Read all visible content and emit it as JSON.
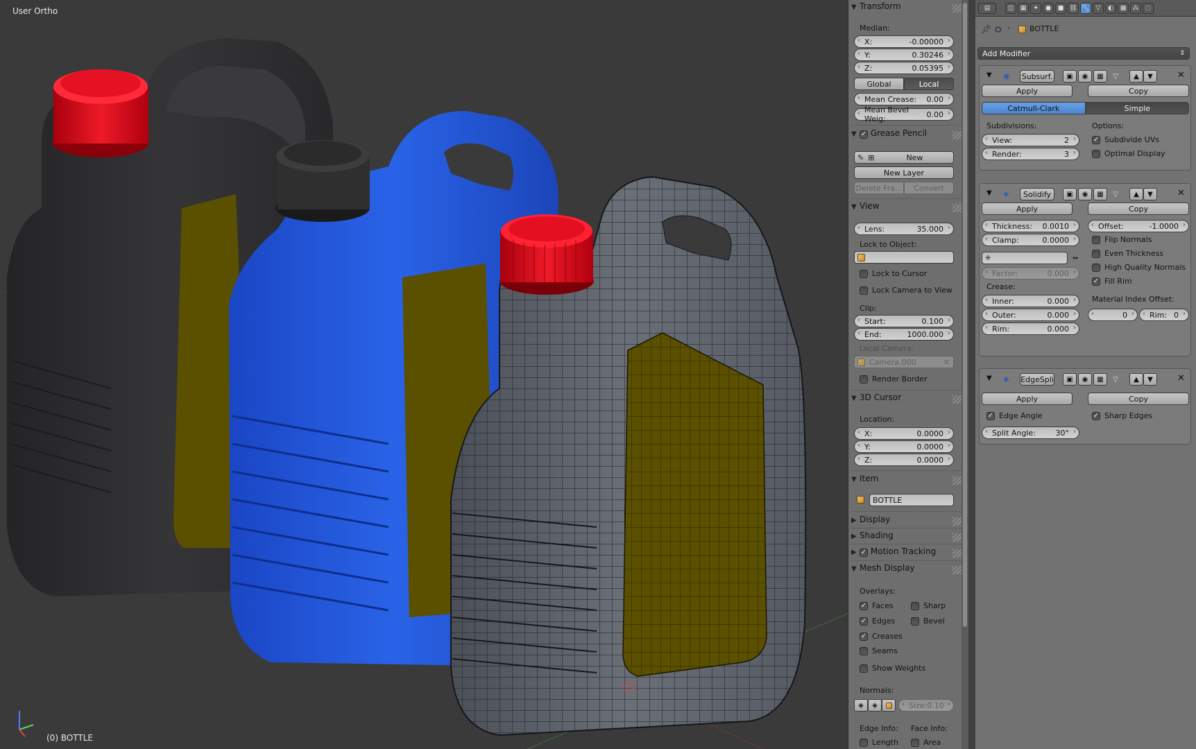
{
  "viewport": {
    "view_name": "User Ortho",
    "object_label": "(0) BOTTLE"
  },
  "npanel": {
    "transform": {
      "header": "Transform",
      "median_label": "Median:",
      "x": {
        "label": "X:",
        "value": "-0.00000"
      },
      "y": {
        "label": "Y:",
        "value": "0.30246"
      },
      "z": {
        "label": "Z:",
        "value": "0.05395"
      },
      "global_label": "Global",
      "local_label": "Local",
      "mean_crease": {
        "label": "Mean Crease:",
        "value": "0.00"
      },
      "mean_bevel": {
        "label": "Mean Bevel Weig:",
        "value": "0.00"
      }
    },
    "grease_pencil": {
      "header": "Grease Pencil",
      "new_label": "New",
      "new_layer_label": "New Layer",
      "delete_frame_label": "Delete Fra...",
      "convert_label": "Convert"
    },
    "view": {
      "header": "View",
      "lens": {
        "label": "Lens:",
        "value": "35.000"
      },
      "lock_to_object_label": "Lock to Object:",
      "lock_to_cursor_label": "Lock to Cursor",
      "lock_camera_label": "Lock Camera to View",
      "clip_label": "Clip:",
      "start": {
        "label": "Start:",
        "value": "0.100"
      },
      "end": {
        "label": "End:",
        "value": "1000.000"
      },
      "local_camera_label": "Local Camera:",
      "camera_value": "Camera.000",
      "render_border_label": "Render Border"
    },
    "cursor": {
      "header": "3D Cursor",
      "location_label": "Location:",
      "x": {
        "label": "X:",
        "value": "0.0000"
      },
      "y": {
        "label": "Y:",
        "value": "0.0000"
      },
      "z": {
        "label": "Z:",
        "value": "0.0000"
      }
    },
    "item": {
      "header": "Item",
      "name": "BOTTLE"
    },
    "display_header": "Display",
    "shading_header": "Shading",
    "motion_tracking_header": "Motion Tracking",
    "mesh_display": {
      "header": "Mesh Display",
      "overlays_label": "Overlays:",
      "faces_label": "Faces",
      "sharp_label": "Sharp",
      "edges_label": "Edges",
      "bevel_label": "Bevel",
      "creases_label": "Creases",
      "seams_label": "Seams",
      "show_weights_label": "Show Weights",
      "normals_label": "Normals:",
      "size": {
        "label": "Size:",
        "value": "0.10"
      },
      "edge_info_label": "Edge Info:",
      "face_info_label": "Face Info:",
      "length_label": "Length",
      "area_label": "Area"
    }
  },
  "properties": {
    "object_name": "BOTTLE",
    "add_modifier_label": "Add Modifier",
    "subsurf": {
      "name": "Subsurf.",
      "apply_label": "Apply",
      "copy_label": "Copy",
      "catmull_label": "Catmull-Clark",
      "simple_label": "Simple",
      "subdivisions_label": "Subdivisions:",
      "options_label": "Options:",
      "view": {
        "label": "View:",
        "value": "2"
      },
      "render": {
        "label": "Render:",
        "value": "3"
      },
      "subdivide_uvs_label": "Subdivide UVs",
      "optimal_display_label": "Optimal Display"
    },
    "solidify": {
      "name": "Solidify",
      "apply_label": "Apply",
      "copy_label": "Copy",
      "thickness": {
        "label": "Thickness:",
        "value": "0.0010"
      },
      "offset": {
        "label": "Offset:",
        "value": "-1.0000"
      },
      "clamp": {
        "label": "Clamp:",
        "value": "0.0000"
      },
      "flip_normals_label": "Flip Normals",
      "even_thickness_label": "Even Thickness",
      "high_quality_label": "High Quality Normals",
      "fill_rim_label": "Fill Rim",
      "factor": {
        "label": "Factor:",
        "value": "0.000"
      },
      "crease_label": "Crease:",
      "inner": {
        "label": "Inner:",
        "value": "0.000"
      },
      "outer": {
        "label": "Outer:",
        "value": "0.000"
      },
      "rim": {
        "label": "Rim:",
        "value": "0.000"
      },
      "material_index_label": "Material Index Offset:",
      "mat_offset_value": "0",
      "mat_rim": {
        "label": "Rim:",
        "value": "0"
      }
    },
    "edgesplit": {
      "name": "EdgeSpli",
      "apply_label": "Apply",
      "copy_label": "Copy",
      "edge_angle_label": "Edge Angle",
      "sharp_edges_label": "Sharp Edges",
      "split_angle": {
        "label": "Split Angle:",
        "value": "30°"
      }
    }
  },
  "colors": {
    "cap_red": "#d0101c",
    "bottle_blue": "#1f52d6",
    "bottle_dark": "#2c2c2e",
    "label_olive": "#5e5200",
    "wire_grey": "#5e636c",
    "accent_blue": "#5b8ad0"
  }
}
